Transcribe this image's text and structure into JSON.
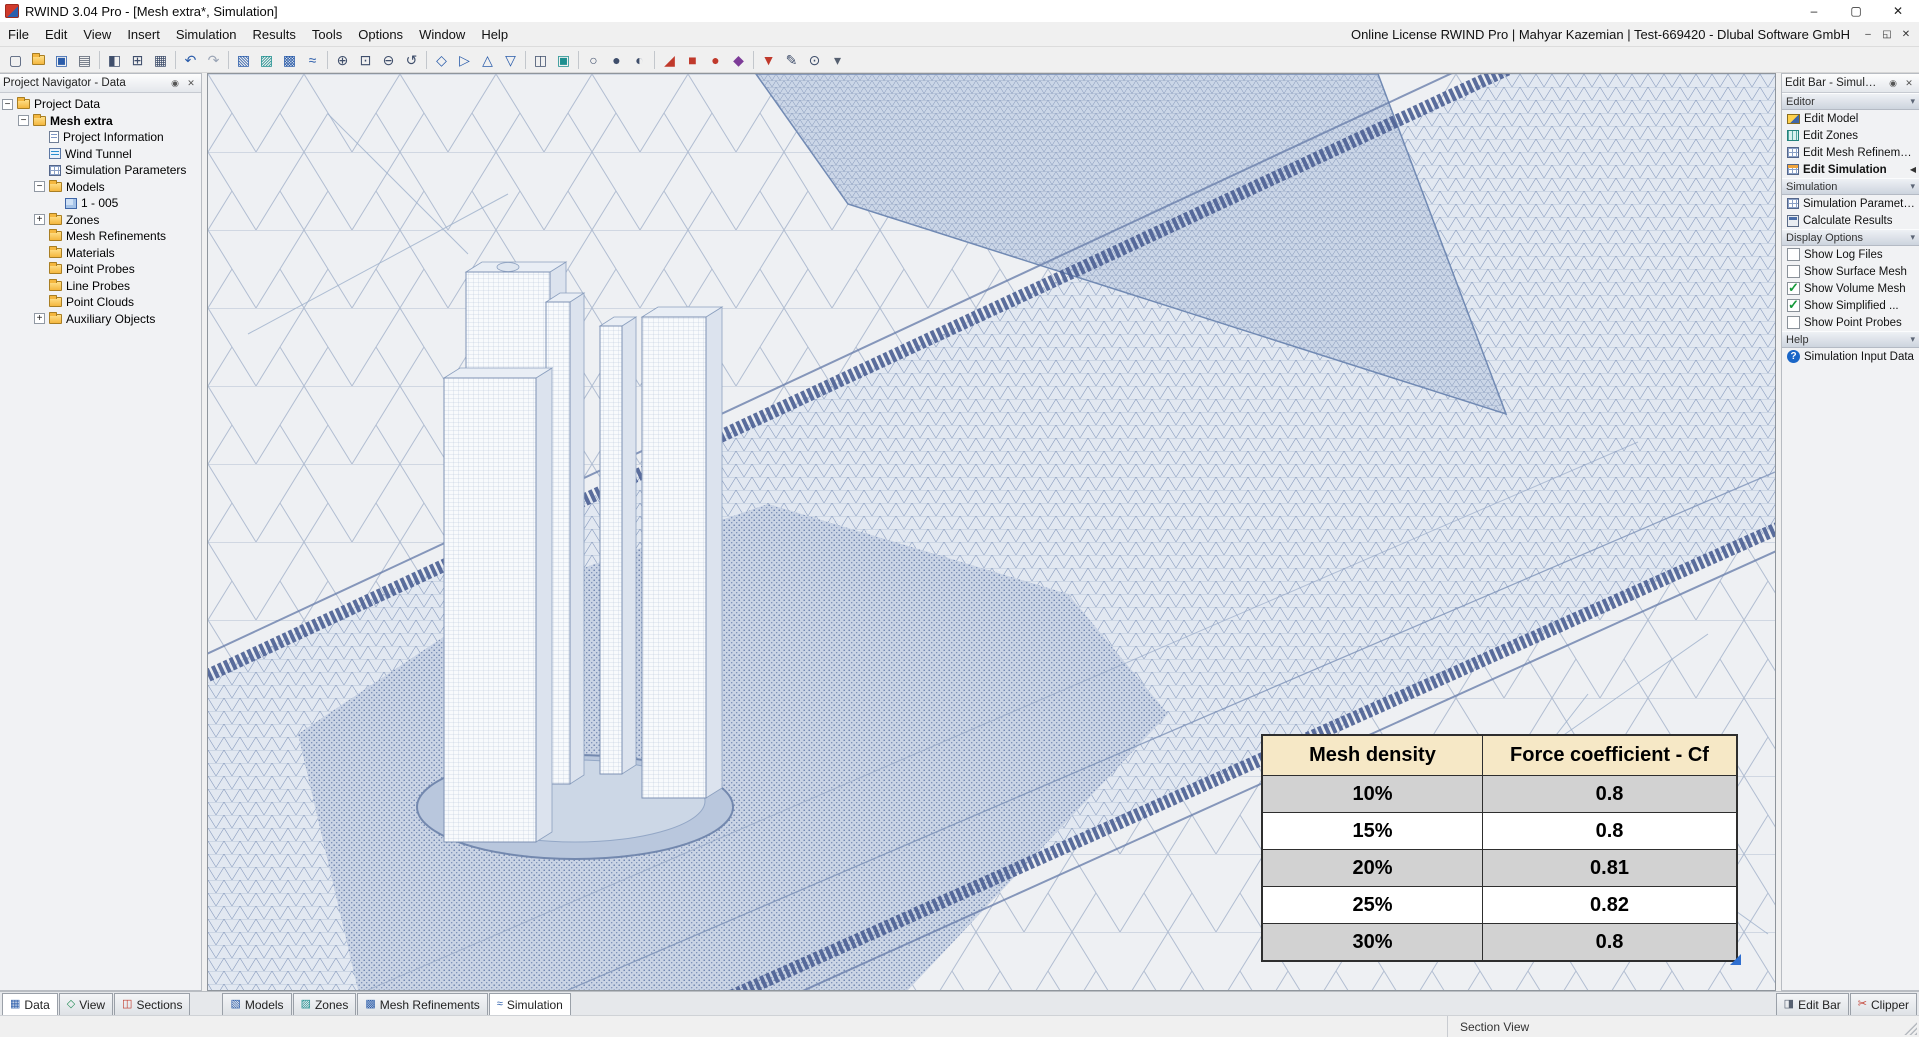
{
  "window": {
    "title": "RWIND 3.04 Pro - [Mesh extra*, Simulation]",
    "controls": {
      "minimize": "–",
      "maximize": "▢",
      "close": "✕"
    },
    "mdi_controls": {
      "minimize": "–",
      "restore": "◱",
      "close": "✕"
    }
  },
  "menu": {
    "items": [
      "File",
      "Edit",
      "View",
      "Insert",
      "Simulation",
      "Results",
      "Tools",
      "Options",
      "Window",
      "Help"
    ],
    "license_text": "Online License RWIND Pro | Mahyar Kazemian | Test-669420 - Dlubal Software GmbH"
  },
  "toolbar": {
    "icons": [
      {
        "name": "new-project",
        "glyph": "▢",
        "color": "#3f4e6b"
      },
      {
        "name": "open-project",
        "cls": "cico-folder"
      },
      {
        "name": "save-project",
        "glyph": "▣",
        "color": "#2a5caa"
      },
      {
        "name": "print",
        "glyph": "▤",
        "color": "#566070"
      },
      {
        "sep": true
      },
      {
        "name": "show-navigator",
        "glyph": "◧",
        "color": "#3f4e6b"
      },
      {
        "name": "show-tables",
        "glyph": "⊞",
        "color": "#3f4e6b"
      },
      {
        "name": "show-grid",
        "glyph": "▦",
        "color": "#3f4e6b"
      },
      {
        "sep": true
      },
      {
        "name": "undo",
        "glyph": "↶",
        "color": "#2a5caa"
      },
      {
        "name": "redo",
        "glyph": "↷",
        "color": "#9aa4b5"
      },
      {
        "sep": true
      },
      {
        "name": "new-model",
        "glyph": "▧",
        "color": "#2a5caa"
      },
      {
        "name": "new-zone",
        "glyph": "▨",
        "color": "#1d8f8f"
      },
      {
        "name": "new-mesh-refinement",
        "glyph": "▩",
        "color": "#2a5caa"
      },
      {
        "name": "wind-profile",
        "glyph": "≈",
        "color": "#2a5caa"
      },
      {
        "sep": true
      },
      {
        "name": "zoom-all",
        "glyph": "⊕",
        "color": "#3f4e6b"
      },
      {
        "name": "zoom-window",
        "glyph": "⊡",
        "color": "#3f4e6b"
      },
      {
        "name": "zoom-out",
        "glyph": "⊖",
        "color": "#3f4e6b"
      },
      {
        "name": "previous-view",
        "glyph": "↺",
        "color": "#3f4e6b"
      },
      {
        "sep": true
      },
      {
        "name": "isometric-view",
        "glyph": "◇",
        "color": "#2a5caa"
      },
      {
        "name": "view-x",
        "glyph": "▷",
        "color": "#2a5caa"
      },
      {
        "name": "view-y",
        "glyph": "△",
        "color": "#2a5caa"
      },
      {
        "name": "view-z",
        "glyph": "▽",
        "color": "#2a5caa"
      },
      {
        "sep": true
      },
      {
        "name": "clipping-plane",
        "glyph": "◫",
        "color": "#3f4e6b"
      },
      {
        "name": "section-box",
        "glyph": "▣",
        "color": "#1d8f8f"
      },
      {
        "sep": true
      },
      {
        "name": "wireframe-display",
        "glyph": "○",
        "color": "#3f4e6b"
      },
      {
        "name": "shaded-display",
        "glyph": "●",
        "color": "#3f4e6b"
      },
      {
        "name": "hidden-line-display",
        "glyph": "◐",
        "color": "#3f4e6b"
      },
      {
        "sep": true
      },
      {
        "name": "delete-results",
        "glyph": "◢",
        "color": "#c0392b"
      },
      {
        "name": "stop-calculation",
        "glyph": "■",
        "color": "#c0392b"
      },
      {
        "name": "record-animation",
        "glyph": "●",
        "color": "#c0392b"
      },
      {
        "name": "show-results",
        "glyph": "◆",
        "color": "#7d3c98"
      },
      {
        "sep": true
      },
      {
        "name": "filter",
        "glyph": "▼",
        "color": "#c0392b"
      },
      {
        "name": "measure",
        "glyph": "✎",
        "color": "#3f4e6b"
      },
      {
        "name": "settings",
        "glyph": "⊙",
        "color": "#3f4e6b"
      },
      {
        "name": "more-tools",
        "glyph": "▾",
        "color": "#566070"
      }
    ]
  },
  "navigator": {
    "title": "Project Navigator - Data",
    "buttons": {
      "pin": "◉",
      "close": "✕"
    },
    "tree": [
      {
        "label": "Project Data",
        "level": 0,
        "expander": "minus",
        "icon": "folder"
      },
      {
        "label": "Mesh extra",
        "level": 1,
        "expander": "minus",
        "icon": "folder",
        "bold": true
      },
      {
        "label": "Project Information",
        "level": 2,
        "icon": "doc"
      },
      {
        "label": "Wind Tunnel",
        "level": 2,
        "icon": "wind"
      },
      {
        "label": "Simulation Parameters",
        "level": 2,
        "icon": "grid"
      },
      {
        "label": "Models",
        "level": 2,
        "expander": "minus",
        "icon": "folder"
      },
      {
        "label": "1 - 005",
        "level": 3,
        "icon": "model"
      },
      {
        "label": "Zones",
        "level": 2,
        "expander": "plus",
        "icon": "folder"
      },
      {
        "label": "Mesh Refinements",
        "level": 2,
        "icon": "folder"
      },
      {
        "label": "Materials",
        "level": 2,
        "icon": "folder"
      },
      {
        "label": "Point Probes",
        "level": 2,
        "icon": "folder"
      },
      {
        "label": "Line Probes",
        "level": 2,
        "icon": "folder"
      },
      {
        "label": "Point Clouds",
        "level": 2,
        "icon": "folder"
      },
      {
        "label": "Auxiliary Objects",
        "level": 2,
        "expander": "plus",
        "icon": "folder"
      }
    ]
  },
  "editbar": {
    "title": "Edit Bar - Simulation",
    "buttons": {
      "pin": "◉",
      "close": "✕"
    },
    "sections": [
      {
        "label": "Editor",
        "items": [
          {
            "label": "Edit Model",
            "icon": "ruler"
          },
          {
            "label": "Edit Zones",
            "icon": "zones"
          },
          {
            "label": "Edit Mesh Refinements",
            "icon": "grid"
          },
          {
            "label": "Edit Simulation",
            "icon": "grid-or",
            "active": true
          }
        ]
      },
      {
        "label": "Simulation",
        "items": [
          {
            "label": "Simulation Parameter ...",
            "icon": "grid"
          },
          {
            "label": "Calculate Results",
            "icon": "calc"
          }
        ]
      },
      {
        "label": "Display Options",
        "checkboxes": [
          {
            "label": "Show Log Files",
            "checked": false
          },
          {
            "label": "Show Surface Mesh",
            "checked": false
          },
          {
            "label": "Show Volume Mesh",
            "checked": true
          },
          {
            "label": "Show Simplified ...",
            "checked": true
          },
          {
            "label": "Show Point Probes",
            "checked": false
          }
        ]
      },
      {
        "label": "Help",
        "items": [
          {
            "label": "Simulation Input Data",
            "icon": "help"
          }
        ]
      }
    ]
  },
  "overlay_table": {
    "headers": [
      "Mesh density",
      "Force coefficient - Cf"
    ],
    "rows": [
      {
        "density": "10%",
        "cf": "0.8"
      },
      {
        "density": "15%",
        "cf": "0.8"
      },
      {
        "density": "20%",
        "cf": "0.81"
      },
      {
        "density": "25%",
        "cf": "0.82"
      },
      {
        "density": "30%",
        "cf": "0.8"
      }
    ],
    "header_bg": "#f6e8c6",
    "row_gray": "#d2d2d2"
  },
  "bottom_tabs": {
    "left": [
      {
        "label": "Data",
        "icon": "data-tab-icon",
        "glyph": "▦",
        "color": "#2a5caa",
        "active": true
      },
      {
        "label": "View",
        "icon": "view-tab-icon",
        "glyph": "◇",
        "color": "#2a8f5a"
      },
      {
        "label": "Sections",
        "icon": "sections-tab-icon",
        "glyph": "◫",
        "color": "#c0392b"
      }
    ],
    "middle": [
      {
        "label": "Models",
        "icon": "models-tab-icon",
        "glyph": "▧",
        "color": "#2a5caa"
      },
      {
        "label": "Zones",
        "icon": "zones-tab-icon",
        "glyph": "▨",
        "color": "#1d8f8f"
      },
      {
        "label": "Mesh Refinements",
        "icon": "mesh-refinements-tab-icon",
        "glyph": "▩",
        "color": "#2a5caa"
      },
      {
        "label": "Simulation",
        "icon": "simulation-tab-icon",
        "glyph": "≈",
        "color": "#2a5caa",
        "active": true
      }
    ],
    "right": [
      {
        "label": "Edit Bar",
        "icon": "edit-bar-tab-icon",
        "glyph": "◨",
        "color": "#566070"
      },
      {
        "label": "Clipper",
        "icon": "clipper-tab-icon",
        "glyph": "✂",
        "color": "#c0392b"
      }
    ]
  },
  "statusbar": {
    "text": "Section View"
  },
  "colors": {
    "mesh_blue": "#7b90b5",
    "mesh_dense": "#4b5f93",
    "viewport_bg": "#eef0f3"
  }
}
